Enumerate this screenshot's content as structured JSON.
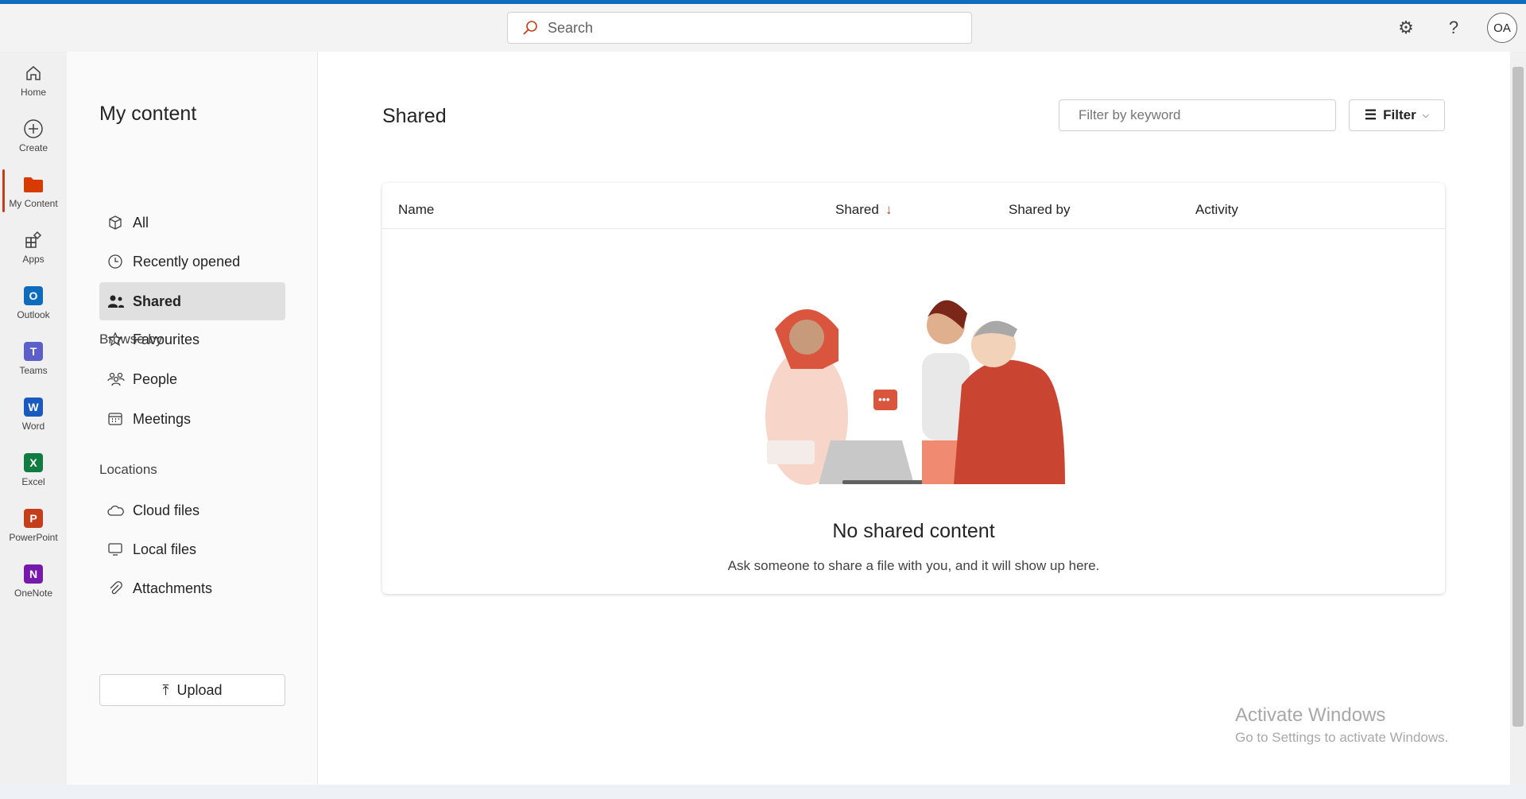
{
  "search": {
    "placeholder": "Search"
  },
  "header": {
    "settings": "settings-icon",
    "help": "?",
    "avatar": "OA"
  },
  "rail": [
    {
      "label": "Home"
    },
    {
      "label": "Create"
    },
    {
      "label": "My Content",
      "active": true
    },
    {
      "label": "Apps"
    },
    {
      "label": "Outlook",
      "letter": "O",
      "color": "#0f6cbd"
    },
    {
      "label": "Teams",
      "letter": "T",
      "color": "#5b5fc7"
    },
    {
      "label": "Word",
      "letter": "W",
      "color": "#185abd"
    },
    {
      "label": "Excel",
      "letter": "X",
      "color": "#107c41"
    },
    {
      "label": "PowerPoint",
      "letter": "P",
      "color": "#c43e1c"
    },
    {
      "label": "OneNote",
      "letter": "N",
      "color": "#7719aa"
    }
  ],
  "panel": {
    "title": "My content",
    "items": [
      {
        "label": "All"
      },
      {
        "label": "Recently opened"
      },
      {
        "label": "Shared"
      },
      {
        "label": "Favourites"
      }
    ],
    "browse_by": "Browse by",
    "browse": [
      {
        "label": "People"
      },
      {
        "label": "Meetings"
      }
    ],
    "locations_label": "Locations",
    "locations": [
      {
        "label": "Cloud files"
      },
      {
        "label": "Local files"
      },
      {
        "label": "Attachments"
      }
    ],
    "upload": "Upload"
  },
  "main": {
    "title": "Shared",
    "filter_placeholder": "Filter by keyword",
    "filter_label": "Filter",
    "columns": [
      "Name",
      "Shared",
      "Shared by",
      "Activity"
    ],
    "empty_title": "No shared content",
    "empty_sub": "Ask someone to share a file with you, and it will show up here."
  },
  "watermark": {
    "line1": "Activate Windows",
    "line2": "Go to Settings to activate Windows."
  },
  "colors": {
    "accent": "#c43e1c",
    "brand": "#0f6cbd"
  }
}
